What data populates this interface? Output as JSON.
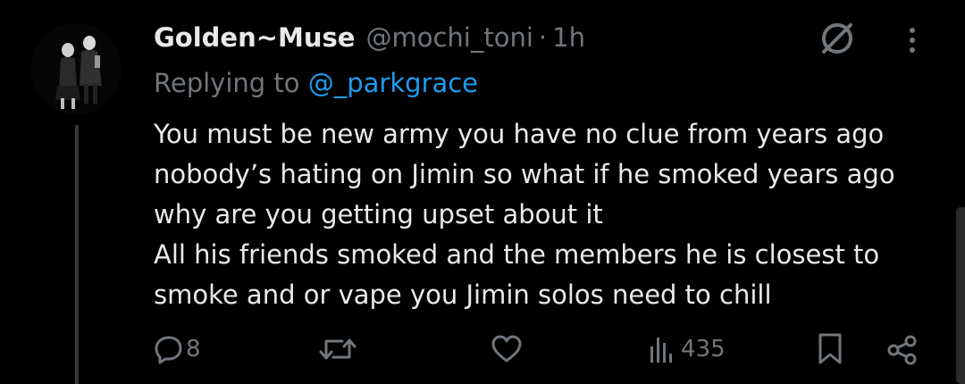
{
  "author": {
    "display_name": "Golden~Muse",
    "handle": "@mochi_toni",
    "separator": "·",
    "time": "1h"
  },
  "replying": {
    "prefix": "Replying to",
    "mention": "@_parkgrace"
  },
  "body_lines": [
    "You must be new army you have no clue from years ago",
    "nobody’s hating on Jimin so what if he smoked years ago",
    "why are you getting upset about it",
    "All his friends smoked and the members he is closest to",
    "smoke and or vape you Jimin solos need to chill"
  ],
  "actions": {
    "reply_count": "8",
    "views_count": "435"
  },
  "icons": {
    "header_right": [
      "no-symbol-icon",
      "more-vertical-icon"
    ],
    "action_bar": [
      "reply-icon",
      "retweet-icon",
      "like-icon",
      "views-icon",
      "bookmark-icon",
      "share-icon"
    ]
  },
  "colors": {
    "background": "#000000",
    "text_primary": "#e7e9ea",
    "text_secondary": "#71767b",
    "link": "#1d9bf0",
    "thread_line": "#333639"
  }
}
